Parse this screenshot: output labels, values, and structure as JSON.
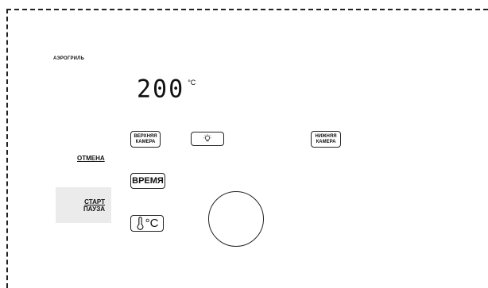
{
  "panel": {
    "mode_label": "АЭРОГРИЛЬ",
    "display": {
      "temperature": "200",
      "unit": "°C"
    }
  },
  "buttons": {
    "upper_chamber": {
      "line1": "ВЕРХНЯЯ",
      "line2": "КАМЕРА"
    },
    "lower_chamber": {
      "line1": "НИЖНЯЯ",
      "line2": "КАМЕРА"
    },
    "light": {
      "icon": "light-bulb-icon"
    },
    "time": {
      "label": "ВРЕМЯ"
    },
    "temperature": {
      "icon": "thermometer-icon",
      "label": "°C"
    },
    "cancel": {
      "label": "ОТМЕНА"
    },
    "start_pause": {
      "line1": "СТАРТ",
      "line2": "ПАУЗА"
    }
  },
  "knob": {
    "icon": "rotary-knob"
  }
}
